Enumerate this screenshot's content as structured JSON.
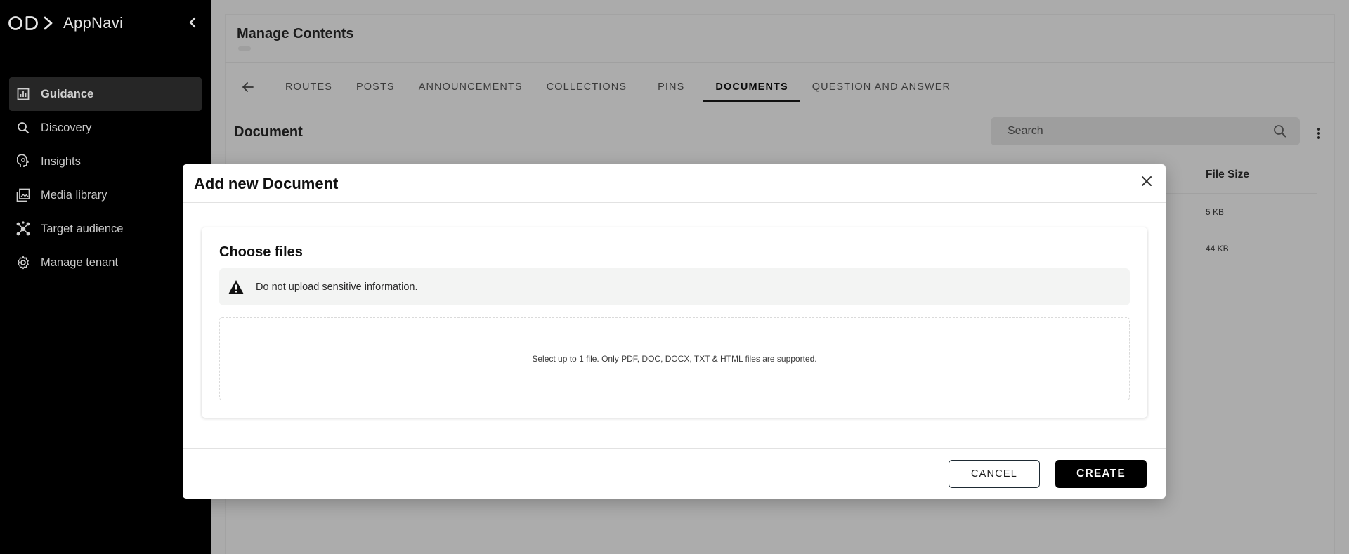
{
  "sidebar": {
    "brand": "AppNavi",
    "items": [
      {
        "label": "Guidance",
        "icon": "chart-icon",
        "active": true
      },
      {
        "label": "Discovery",
        "icon": "search-icon",
        "active": false
      },
      {
        "label": "Insights",
        "icon": "head-icon",
        "active": false
      },
      {
        "label": "Media library",
        "icon": "gallery-icon",
        "active": false
      },
      {
        "label": "Target audience",
        "icon": "network-icon",
        "active": false
      },
      {
        "label": "Manage tenant",
        "icon": "gear-icon",
        "active": false
      }
    ]
  },
  "page": {
    "title": "Manage Contents",
    "tabs": [
      {
        "label": "ROUTES"
      },
      {
        "label": "POSTS"
      },
      {
        "label": "ANNOUNCEMENTS"
      },
      {
        "label": "COLLECTIONS"
      },
      {
        "label": "PINS"
      },
      {
        "label": "DOCUMENTS",
        "active": true
      },
      {
        "label": "QUESTION AND ANSWER"
      }
    ],
    "section_title": "Document",
    "search": {
      "placeholder": "Search"
    },
    "table": {
      "columns": [
        "File Size"
      ],
      "rows": [
        {
          "file_size": "5 KB"
        },
        {
          "file_size": "44 KB"
        }
      ]
    }
  },
  "modal": {
    "title": "Add new Document",
    "card_title": "Choose files",
    "warning": "Do not upload sensitive information.",
    "dropzone_text": "Select up to 1 file. Only PDF, DOC, DOCX, TXT & HTML files are supported.",
    "cancel_label": "CANCEL",
    "create_label": "CREATE"
  },
  "colors": {
    "sidebar_bg": "#000000",
    "overlay_bg": "#ababab",
    "primary_button": "#000000"
  }
}
